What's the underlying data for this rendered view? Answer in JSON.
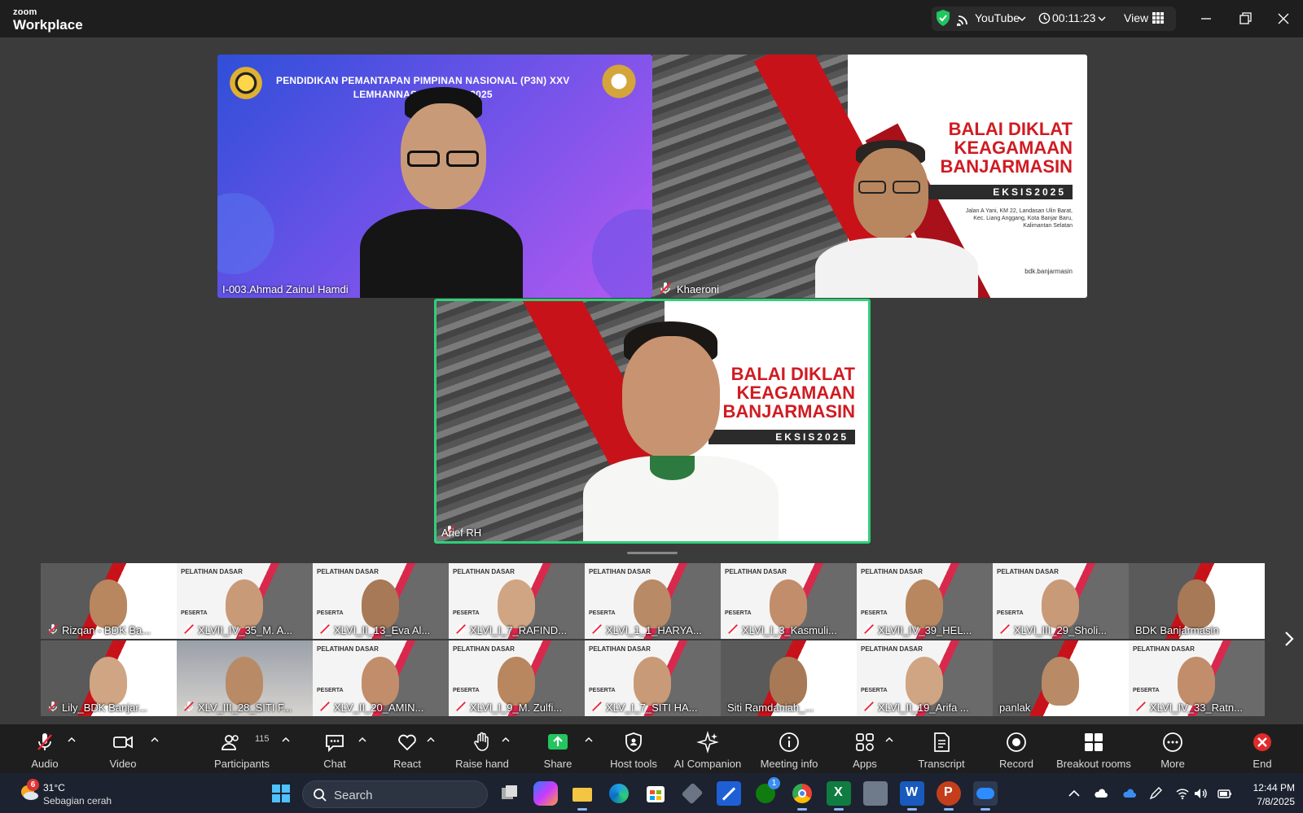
{
  "app": {
    "brand_top": "zoom",
    "brand_bottom": "Workplace"
  },
  "titlebar": {
    "stream_label": "YouTube",
    "timer": "00:11:23",
    "view_label": "View"
  },
  "speakers": [
    {
      "name": "I-003.Ahmad Zainul Hamdi",
      "muted": false
    },
    {
      "name": "Khaeroni",
      "muted": true
    },
    {
      "name": "Arief RH",
      "muted": true
    }
  ],
  "banner": {
    "line1": "PENDIDIKAN PEMANTAPAN PIMPINAN NASIONAL (P3N) XXV",
    "line2": "LEMHANNAS RI TAHUN 2025"
  },
  "bdk": {
    "title_lines": [
      "BALAI DIKLAT",
      "KEAGAMAAN",
      "BANJARMASIN"
    ],
    "tag": "EKSIS2025",
    "address_lines": [
      "Jalan A Yani, KM 22, Landasan Ulin Barat,",
      "Kec. Liang Anggang, Kota Banjar Baru,",
      "Kalimantan Selatan"
    ],
    "handle": "bdk.banjarmasin"
  },
  "gallery": [
    {
      "name": "Rizqan - BDK Ba...",
      "muted": true,
      "bg": "bdk"
    },
    {
      "name": "XLVII_IV_35_M. A...",
      "muted": true,
      "bg": "pelatihan"
    },
    {
      "name": "XLVI_II_13_Eva Al...",
      "muted": true,
      "bg": "pelatihan"
    },
    {
      "name": "XLVI_I_7_RAFIND...",
      "muted": true,
      "bg": "pelatihan"
    },
    {
      "name": "XLVI_1_1_HARYA...",
      "muted": true,
      "bg": "pelatihan"
    },
    {
      "name": "XLVI_I_3_Kasmuli...",
      "muted": true,
      "bg": "pelatihan"
    },
    {
      "name": "XLVII_IV_39_HEL...",
      "muted": true,
      "bg": "pelatihan"
    },
    {
      "name": "XLVI_III_29_Sholi...",
      "muted": true,
      "bg": "pelatihan"
    },
    {
      "name": "BDK Banjarmasin",
      "muted": false,
      "bg": "bdk"
    },
    {
      "name": "Lily_BDK Banjar...",
      "muted": true,
      "bg": "bdk"
    },
    {
      "name": "XLV_III_28_SITI F...",
      "muted": true,
      "bg": "room"
    },
    {
      "name": "XLV_II_20_AMIN...",
      "muted": true,
      "bg": "pelatihan"
    },
    {
      "name": "XLVI_I_9_M. Zulfi...",
      "muted": true,
      "bg": "pelatihan"
    },
    {
      "name": "XLV_I_7_SITI HA...",
      "muted": true,
      "bg": "pelatihan"
    },
    {
      "name": "Siti Ramdaniah_...",
      "muted": false,
      "bg": "bdk"
    },
    {
      "name": "XLVI_II_19_Arifa ...",
      "muted": true,
      "bg": "pelatihan"
    },
    {
      "name": "panlak",
      "muted": false,
      "bg": "bdk"
    },
    {
      "name": "XLVI_IV_33_Ratn...",
      "muted": true,
      "bg": "pelatihan"
    }
  ],
  "gallery_labels": {
    "peserta": "PESERTA",
    "pelatihan": "PELATIHAN DASAR"
  },
  "toolbar": {
    "audio": "Audio",
    "video": "Video",
    "participants": "Participants",
    "participants_count": "115",
    "chat": "Chat",
    "react": "React",
    "raise_hand": "Raise hand",
    "share": "Share",
    "host_tools": "Host tools",
    "ai_companion": "AI Companion",
    "meeting_info": "Meeting info",
    "apps": "Apps",
    "transcript": "Transcript",
    "record": "Record",
    "breakout_rooms": "Breakout rooms",
    "more": "More",
    "end": "End"
  },
  "taskbar": {
    "weather_badge": "6",
    "temperature": "31°C",
    "condition": "Sebagian cerah",
    "search_placeholder": "Search",
    "time": "12:44 PM",
    "date": "7/8/2025",
    "xbox_badge": "1"
  },
  "colors": {
    "active_speaker": "#2fd07a",
    "share_green": "#22c55e",
    "end_red": "#e02b2b",
    "bdk_red": "#c8121a"
  }
}
